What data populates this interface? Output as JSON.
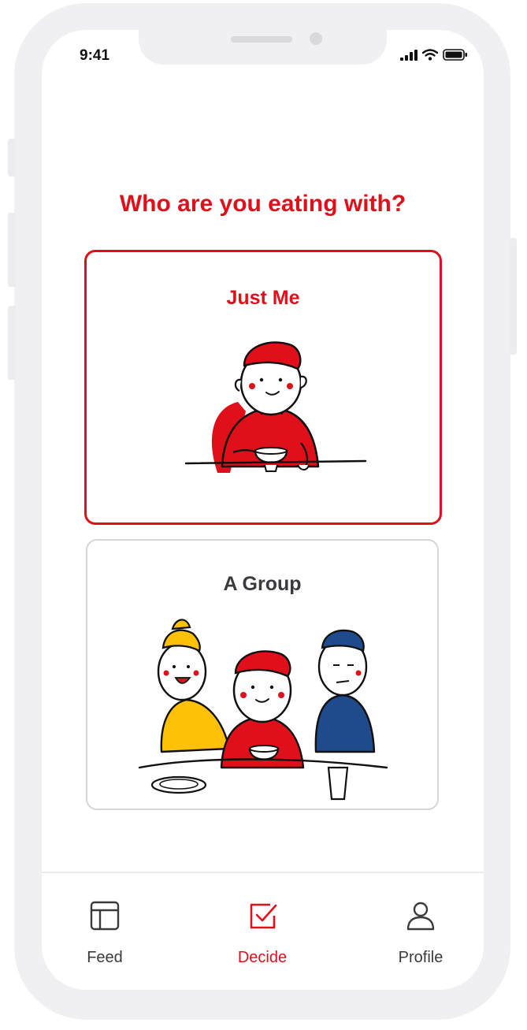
{
  "status_bar": {
    "time": "9:41"
  },
  "main": {
    "title": "Who are you eating with?"
  },
  "options": [
    {
      "label": "Just Me",
      "selected": true
    },
    {
      "label": "A Group",
      "selected": false
    }
  ],
  "tabs": [
    {
      "label": "Feed",
      "icon": "layout-icon",
      "active": false
    },
    {
      "label": "Decide",
      "icon": "checkbox-icon",
      "active": true
    },
    {
      "label": "Profile",
      "icon": "user-icon",
      "active": false
    }
  ],
  "colors": {
    "accent": "#e0101b",
    "yellow": "#ffc107",
    "blue": "#1f4a8c"
  }
}
